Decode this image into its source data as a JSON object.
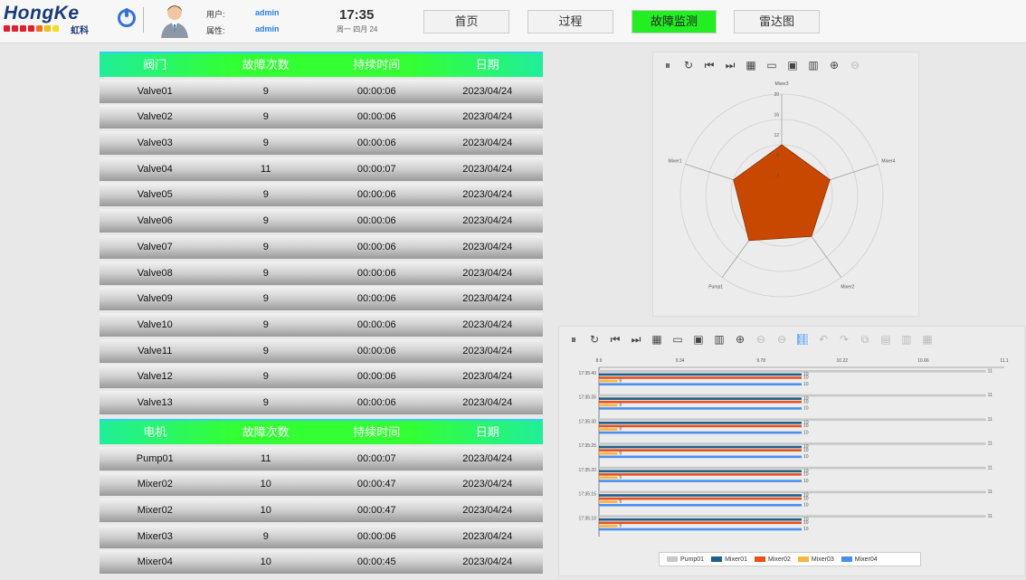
{
  "header": {
    "logo": "HongKe",
    "logo_cn": "虹科",
    "user_label": "用户:",
    "user_value": "admin",
    "attr_label": "属性:",
    "attr_value": "admin",
    "time": "17:35",
    "date": "周一 四月 24",
    "nav": [
      {
        "label": "首页"
      },
      {
        "label": "过程"
      },
      {
        "label": "故障监测",
        "active": true
      },
      {
        "label": "雷达图"
      }
    ]
  },
  "valve_table": {
    "headers": [
      "阀门",
      "故障次数",
      "持续时间",
      "日期"
    ],
    "rows": [
      [
        "Valve01",
        "9",
        "00:00:06",
        "2023/04/24"
      ],
      [
        "Valve02",
        "9",
        "00:00:06",
        "2023/04/24"
      ],
      [
        "Valve03",
        "9",
        "00:00:06",
        "2023/04/24"
      ],
      [
        "Valve04",
        "11",
        "00:00:07",
        "2023/04/24"
      ],
      [
        "Valve05",
        "9",
        "00:00:06",
        "2023/04/24"
      ],
      [
        "Valve06",
        "9",
        "00:00:06",
        "2023/04/24"
      ],
      [
        "Valve07",
        "9",
        "00:00:06",
        "2023/04/24"
      ],
      [
        "Valve08",
        "9",
        "00:00:06",
        "2023/04/24"
      ],
      [
        "Valve09",
        "9",
        "00:00:06",
        "2023/04/24"
      ],
      [
        "Valve10",
        "9",
        "00:00:06",
        "2023/04/24"
      ],
      [
        "Valve11",
        "9",
        "00:00:06",
        "2023/04/24"
      ],
      [
        "Valve12",
        "9",
        "00:00:06",
        "2023/04/24"
      ],
      [
        "Valve13",
        "9",
        "00:00:06",
        "2023/04/24"
      ]
    ]
  },
  "motor_table": {
    "headers": [
      "电机",
      "故障次数",
      "持续时间",
      "日期"
    ],
    "rows": [
      [
        "Pump01",
        "11",
        "00:00:07",
        "2023/04/24"
      ],
      [
        "Mixer02",
        "10",
        "00:00:47",
        "2023/04/24"
      ],
      [
        "Mixer02",
        "10",
        "00:00:47",
        "2023/04/24"
      ],
      [
        "Mixer03",
        "9",
        "00:00:06",
        "2023/04/24"
      ],
      [
        "Mixer04",
        "10",
        "00:00:45",
        "2023/04/24"
      ]
    ]
  },
  "colors": {
    "accent": "#33ff33",
    "radar_fill": "#c84800",
    "pump": "#c8c8c8",
    "mixer01": "#1f5f8b",
    "mixer02": "#e8501a",
    "mixer03": "#ffb43c",
    "mixer04": "#4a8ff0"
  },
  "chart_data": [
    {
      "type": "radar",
      "axes": [
        "Mixer3",
        "Mixer4",
        "Mixer2",
        "Pump1",
        "Mixer1"
      ],
      "values": [
        10,
        10,
        10,
        11,
        10
      ],
      "rlim": [
        0,
        20
      ],
      "ticks": [
        "4",
        "8",
        "12",
        "16",
        "20"
      ]
    },
    {
      "type": "bar",
      "orientation": "horizontal",
      "categories": [
        "17:35:40",
        "17:35:35",
        "17:35:30",
        "17:35:25",
        "17:35:20",
        "17:35:15",
        "17:35:10"
      ],
      "x_ticks": [
        "8.9",
        "9.34",
        "9.78",
        "10.22",
        "10.66",
        "11.1"
      ],
      "xlim": [
        8.9,
        11.1
      ],
      "series": [
        {
          "name": "Pump01",
          "values": [
            11,
            11,
            11,
            11,
            11,
            11,
            11
          ]
        },
        {
          "name": "Mixer01",
          "values": [
            10,
            10,
            10,
            10,
            10,
            10,
            10
          ]
        },
        {
          "name": "Mixer02",
          "values": [
            10,
            10,
            10,
            10,
            10,
            10,
            10
          ]
        },
        {
          "name": "Mixer03",
          "values": [
            9,
            9,
            9,
            9,
            9,
            9,
            9
          ]
        },
        {
          "name": "Mixer04",
          "values": [
            10,
            10,
            10,
            10,
            10,
            10,
            10
          ]
        }
      ]
    }
  ]
}
